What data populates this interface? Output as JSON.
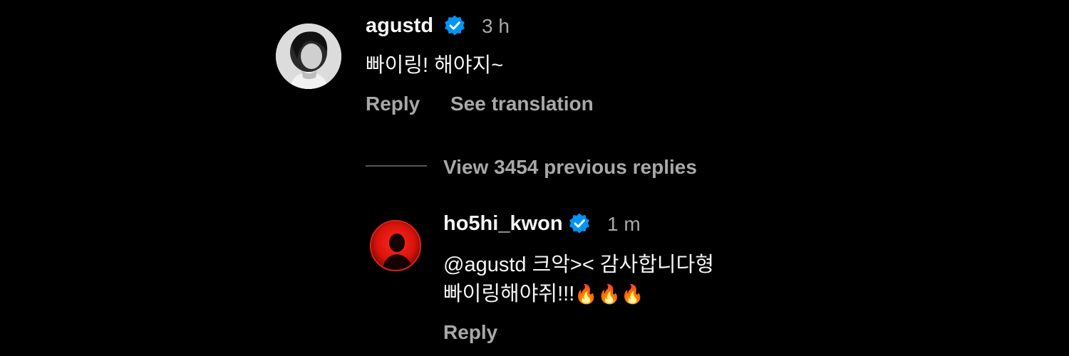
{
  "comments": [
    {
      "username": "agustd",
      "verified": true,
      "time": "3 h",
      "text": "빠이링! 해야지~",
      "actions": {
        "reply": "Reply",
        "translate": "See translation"
      }
    }
  ],
  "view_previous": {
    "label": "View 3454 previous replies"
  },
  "replies": [
    {
      "username": "ho5hi_kwon",
      "verified": true,
      "time": "1 m",
      "text_line1": "@agustd 크악>< 감사합니다형",
      "text_line2": "빠이링해야쥐!!!",
      "emojis": "🔥🔥🔥",
      "actions": {
        "reply": "Reply"
      }
    }
  ],
  "colors": {
    "background": "#000000",
    "primary_text": "#f5f5f5",
    "secondary_text": "#a8a8a8",
    "verified_badge": "#0095f6",
    "divider": "#555555"
  },
  "icons": {
    "verified": "verified-badge-icon",
    "fire": "fire-emoji-icon"
  }
}
